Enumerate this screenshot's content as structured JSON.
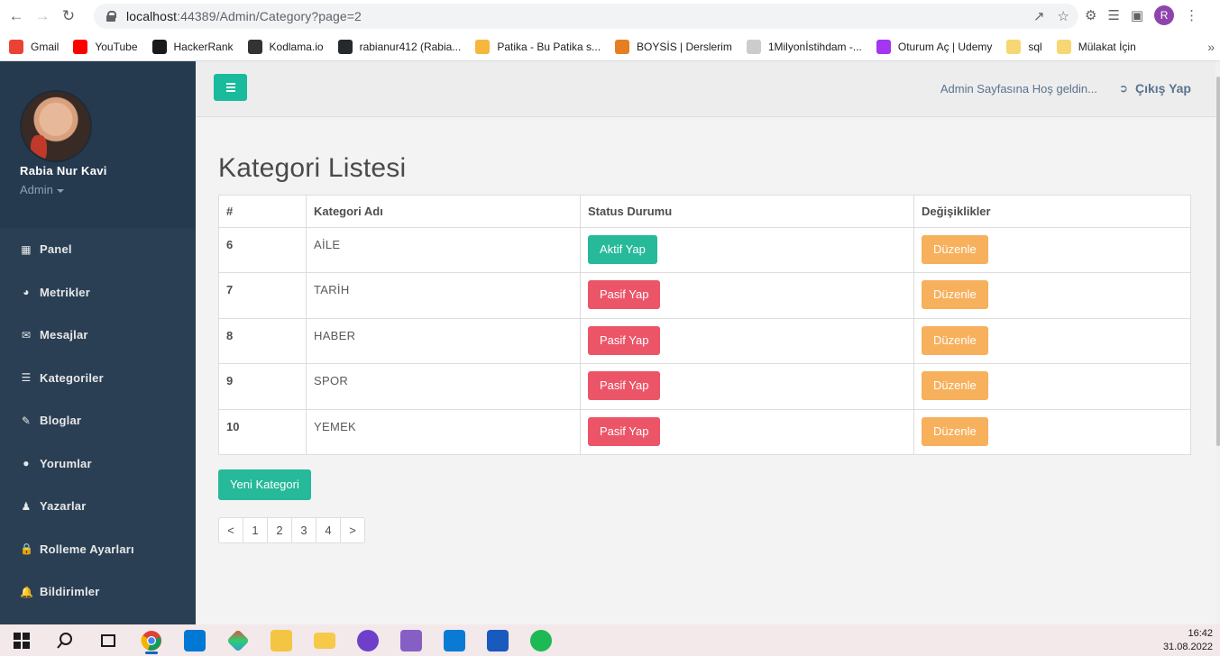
{
  "browser": {
    "url_host": "localhost",
    "url_path": ":44389/Admin/Category?page=2",
    "profile_initial": "R"
  },
  "bookmarks": [
    {
      "label": "Gmail",
      "color": "#ea4335"
    },
    {
      "label": "YouTube",
      "color": "#ff0000"
    },
    {
      "label": "HackerRank",
      "color": "#1a1a1a"
    },
    {
      "label": "Kodlama.io",
      "color": "#333333"
    },
    {
      "label": "rabianur412 (Rabia...",
      "color": "#24292e"
    },
    {
      "label": "Patika - Bu Patika s...",
      "color": "#f6b73c"
    },
    {
      "label": "BOYSİS | Derslerim",
      "color": "#e67e22"
    },
    {
      "label": "1Milyonİstihdam -...",
      "color": "#cccccc"
    },
    {
      "label": "Oturum Aç | Udemy",
      "color": "#a435f0"
    },
    {
      "label": "sql",
      "color": "#f7d774"
    },
    {
      "label": "Mülakat İçin",
      "color": "#f7d774"
    }
  ],
  "sidebar": {
    "user_name": "Rabia Nur Kavi",
    "user_role": "Admin",
    "items": [
      {
        "label": "Panel",
        "icon": "▦"
      },
      {
        "label": "Metrikler",
        "icon": "◕"
      },
      {
        "label": "Mesajlar",
        "icon": "✉"
      },
      {
        "label": "Kategoriler",
        "icon": "☰"
      },
      {
        "label": "Bloglar",
        "icon": "✎"
      },
      {
        "label": "Yorumlar",
        "icon": "●"
      },
      {
        "label": "Yazarlar",
        "icon": "♟"
      },
      {
        "label": "Rolleme Ayarları",
        "icon": "🔒"
      },
      {
        "label": "Bildirimler",
        "icon": "🔔"
      }
    ]
  },
  "topbar": {
    "welcome": "Admin Sayfasına Hoş geldin...",
    "logout": "Çıkış Yap"
  },
  "page": {
    "title": "Kategori Listesi",
    "new_button": "Yeni Kategori"
  },
  "table": {
    "headers": [
      "#",
      "Kategori Adı",
      "Status Durumu",
      "Değişiklikler"
    ],
    "rows": [
      {
        "id": "6",
        "name": "AİLE",
        "status_label": "Aktif Yap",
        "status_type": "success",
        "edit_label": "Düzenle"
      },
      {
        "id": "7",
        "name": "TARİH",
        "status_label": "Pasif Yap",
        "status_type": "danger",
        "edit_label": "Düzenle"
      },
      {
        "id": "8",
        "name": "HABER",
        "status_label": "Pasif Yap",
        "status_type": "danger",
        "edit_label": "Düzenle"
      },
      {
        "id": "9",
        "name": "SPOR",
        "status_label": "Pasif Yap",
        "status_type": "danger",
        "edit_label": "Düzenle"
      },
      {
        "id": "10",
        "name": "YEMEK",
        "status_label": "Pasif Yap",
        "status_type": "danger",
        "edit_label": "Düzenle"
      }
    ]
  },
  "pager": [
    "<",
    "1",
    "2",
    "3",
    "4",
    ">"
  ],
  "taskbar": {
    "time": "16:42",
    "date": "31.08.2022"
  },
  "colors": {
    "primary": "#26b99a",
    "danger": "#ec5568",
    "warning": "#f7b05c",
    "sidebar": "#2a3f54"
  }
}
